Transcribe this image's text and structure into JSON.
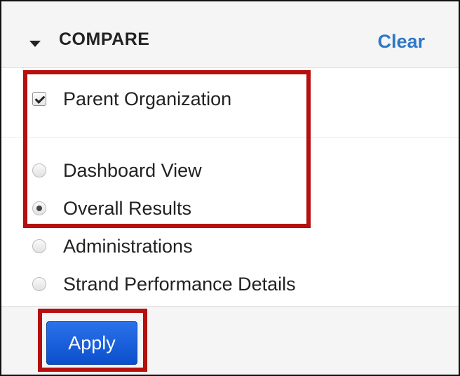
{
  "compare": {
    "title": "COMPARE",
    "clear_label": "Clear"
  },
  "options": {
    "checkbox": {
      "label": "Parent Organization",
      "checked": true
    },
    "radios": [
      {
        "label": "Dashboard View",
        "checked": false
      },
      {
        "label": "Overall Results",
        "checked": true
      },
      {
        "label": "Administrations",
        "checked": false
      },
      {
        "label": "Strand Performance Details",
        "checked": false
      }
    ]
  },
  "footer": {
    "apply_label": "Apply"
  },
  "colors": {
    "highlight": "#b50f0f",
    "link": "#2f77c6",
    "apply_button": "#0b4fcc"
  }
}
